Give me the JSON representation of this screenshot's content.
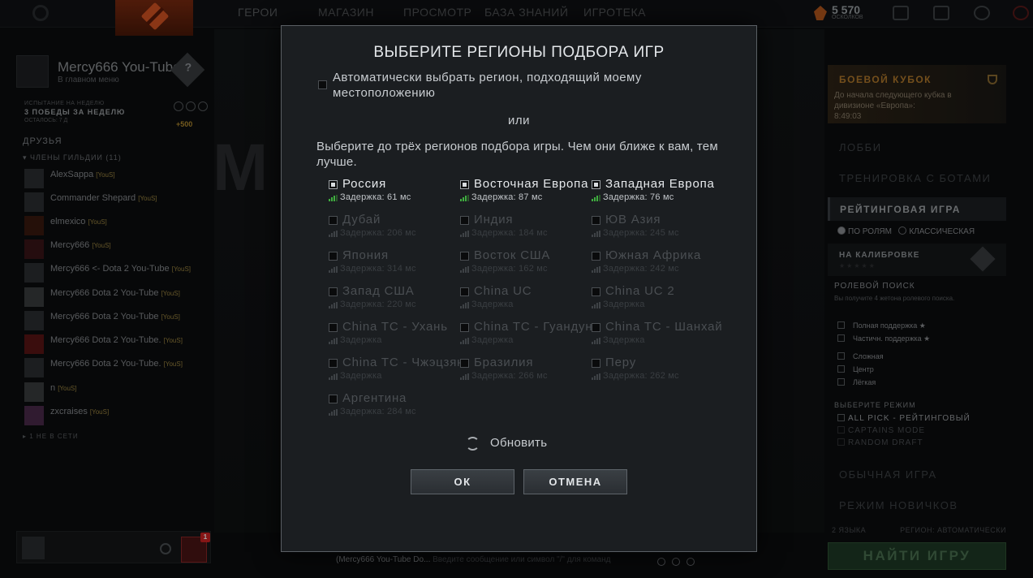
{
  "topbar": {
    "nav": [
      "ГЕРОИ",
      "МАГАЗИН",
      "ПРОСМОТР",
      "БАЗА ЗНАНИЙ",
      "ИГРОТЕКА"
    ],
    "shards_count": "5 570",
    "shards_label": "ОСКОЛКОВ"
  },
  "profile": {
    "name": "Mercy666 You-Tube",
    "status": "В главном меню",
    "rank_symbol": "?"
  },
  "challenge": {
    "label": "ИСПЫТАНИЕ НА НЕДЕЛЮ",
    "title": "3 ПОБЕДЫ ЗА НЕДЕЛЮ",
    "remaining": "ОСТАЛОСЬ: 7 Д",
    "bonus": "+500"
  },
  "friends": {
    "header": "ДРУЗЬЯ",
    "guild_header": "ЧЛЕНЫ ГИЛЬДИИ (11)",
    "list": [
      {
        "name": "AlexSappa",
        "tag": "[YouS]"
      },
      {
        "name": "Commander Shepard",
        "tag": "[YouS]"
      },
      {
        "name": "elmexico",
        "tag": "[YouS]"
      },
      {
        "name": "Mercy666",
        "tag": "[YouS]"
      },
      {
        "name": "Mercy666 <- Dota 2 You-Tube",
        "tag": "[YouS]"
      },
      {
        "name": "Mercy666 Dota 2 You-Tube",
        "tag": "[YouS]"
      },
      {
        "name": "Mercy666 Dota 2 You-Tube",
        "tag": "[YouS]"
      },
      {
        "name": "Mercy666 Dota 2 You-Tube.",
        "tag": "[YouS]"
      },
      {
        "name": "Mercy666 Dota 2 You-Tube.",
        "tag": "[YouS]"
      },
      {
        "name": "n",
        "tag": "[YouS]"
      },
      {
        "name": "zxcraises",
        "tag": "[YouS]"
      }
    ],
    "offline": "1 НЕ В СЕТИ",
    "notification_count": "1"
  },
  "chat": {
    "channel": "(Mercy666 You-Tube Do...",
    "placeholder": "Введите сообщение или символ \"/\" для команд"
  },
  "right": {
    "cup_title": "БОЕВОЙ КУБОК",
    "cup_desc": "До начала следующего кубка в дивизионе «Европа»:",
    "cup_timer": "8:49:03",
    "lobby": "ЛОББИ",
    "bots": "ТРЕНИРОВКА С БОТАМИ",
    "ranked": "РЕЙТИНГОВАЯ ИГРА",
    "by_roles": "ПО РОЛЯМ",
    "classic": "КЛАССИЧЕСКАЯ",
    "calibration": "НА КАЛИБРОВКЕ",
    "role_search": "РОЛЕВОЙ ПОИСК",
    "role_hint": "Вы получите 4 жетона ролевого поиска.",
    "roles": [
      "Полная поддержка ★",
      "Частичн. поддержка ★",
      "Сложная",
      "Центр",
      "Лёгкая"
    ],
    "mode_header": "ВЫБЕРИТЕ РЕЖИМ",
    "modes": [
      "ALL PICK - РЕЙТИНГОВЫЙ",
      "CAPTAINS MODE",
      "RANDOM DRAFT"
    ],
    "normal": "ОБЫЧНАЯ ИГРА",
    "newbie": "РЕЖИМ НОВИЧКОВ",
    "languages": "2 ЯЗЫКА",
    "region": "РЕГИОН: АВТОМАТИЧЕСКИ",
    "find": "НАЙТИ ИГРУ"
  },
  "background": {
    "big_letter": "M"
  },
  "modal": {
    "title": "ВЫБЕРИТЕ РЕГИОНЫ ПОДБОРА ИГР",
    "auto_label": "Автоматически выбрать регион, подходящий моему местоположению",
    "or": "или",
    "instructions": "Выберите до трёх регионов подбора игры. Чем они ближе к вам, тем лучше.",
    "regions": [
      {
        "name": "Россия",
        "ping": "Задержка: 61 мс",
        "checked": true
      },
      {
        "name": "Восточная Европа",
        "ping": "Задержка: 87 мс",
        "checked": true
      },
      {
        "name": "Западная Европа",
        "ping": "Задержка: 76 мс",
        "checked": true
      },
      {
        "name": "Дубай",
        "ping": "Задержка: 206 мс",
        "checked": false
      },
      {
        "name": "Индия",
        "ping": "Задержка: 184 мс",
        "checked": false
      },
      {
        "name": "ЮВ Азия",
        "ping": "Задержка: 245 мс",
        "checked": false
      },
      {
        "name": "Япония",
        "ping": "Задержка: 314 мс",
        "checked": false
      },
      {
        "name": "Восток США",
        "ping": "Задержка: 162 мс",
        "checked": false
      },
      {
        "name": "Южная Африка",
        "ping": "Задержка: 242 мс",
        "checked": false
      },
      {
        "name": "Запад США",
        "ping": "Задержка: 220 мс",
        "checked": false
      },
      {
        "name": "China UC",
        "ping": "Задержка",
        "checked": false
      },
      {
        "name": "China UC 2",
        "ping": "Задержка",
        "checked": false
      },
      {
        "name": "China TC - Ухань",
        "ping": "Задержка",
        "checked": false
      },
      {
        "name": "China TC - Гуандун",
        "ping": "Задержка",
        "checked": false
      },
      {
        "name": "China TC - Шанхай",
        "ping": "Задержка",
        "checked": false
      },
      {
        "name": "China TC - Чжэцзян",
        "ping": "Задержка",
        "checked": false
      },
      {
        "name": "Бразилия",
        "ping": "Задержка: 266 мс",
        "checked": false
      },
      {
        "name": "Перу",
        "ping": "Задержка: 262 мс",
        "checked": false
      },
      {
        "name": "Аргентина",
        "ping": "Задержка: 284 мс",
        "checked": false
      }
    ],
    "refresh": "Обновить",
    "ok": "ОК",
    "cancel": "ОТМЕНА"
  }
}
